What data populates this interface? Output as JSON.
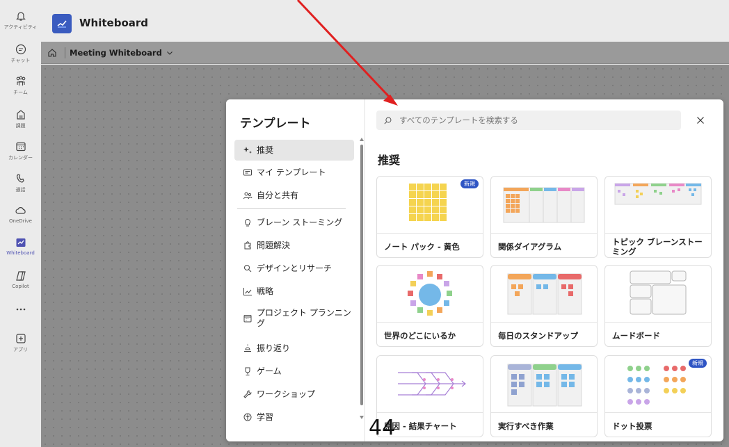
{
  "rail": {
    "items": [
      {
        "label": "アクティビティ",
        "icon": "bell-icon"
      },
      {
        "label": "チャット",
        "icon": "chat-icon"
      },
      {
        "label": "チーム",
        "icon": "teams-icon"
      },
      {
        "label": "課題",
        "icon": "assignment-icon"
      },
      {
        "label": "カレンダー",
        "icon": "calendar-icon"
      },
      {
        "label": "通話",
        "icon": "phone-icon"
      },
      {
        "label": "OneDrive",
        "icon": "cloud-icon"
      },
      {
        "label": "Whiteboard",
        "icon": "whiteboard-icon"
      },
      {
        "label": "Copilot",
        "icon": "copilot-icon"
      },
      {
        "label": "アプリ",
        "icon": "add-app-icon"
      }
    ],
    "active": "Whiteboard",
    "accent": "#4f52b2"
  },
  "header": {
    "app_title": "Whiteboard"
  },
  "breadcrumb": {
    "title": "Meeting Whiteboard"
  },
  "dialog": {
    "title": "テンプレート",
    "categories": [
      {
        "label": "推奨",
        "icon": "sparkle-icon",
        "selected": true
      },
      {
        "label": "マイ テンプレート",
        "icon": "template-icon"
      },
      {
        "label": "自分と共有",
        "icon": "people-icon"
      },
      {
        "label": "ブレーン ストーミング",
        "icon": "lightbulb-icon"
      },
      {
        "label": "問題解決",
        "icon": "puzzle-icon"
      },
      {
        "label": "デザインとリサーチ",
        "icon": "search-icon"
      },
      {
        "label": "戦略",
        "icon": "chart-icon"
      },
      {
        "label": "プロジェクト プランニング",
        "icon": "calendar-icon"
      },
      {
        "label": "振り返り",
        "icon": "retro-icon"
      },
      {
        "label": "ゲーム",
        "icon": "trophy-icon"
      },
      {
        "label": "ワークショップ",
        "icon": "wrench-icon"
      },
      {
        "label": "学習",
        "icon": "learning-icon"
      }
    ],
    "search": {
      "placeholder": "すべてのテンプレートを検索する"
    },
    "section_title": "推奨",
    "templates": [
      {
        "label": "ノート パック - 黄色",
        "badge": "新規"
      },
      {
        "label": "関係ダイアグラム"
      },
      {
        "label": "トピック ブレーンストーミング"
      },
      {
        "label": "世界のどこにいるか"
      },
      {
        "label": "毎日のスタンドアップ"
      },
      {
        "label": "ムードボード"
      },
      {
        "label": "原因 - 結果チャート"
      },
      {
        "label": "実行すべき作業"
      },
      {
        "label": "ドット投票",
        "badge": "新規"
      }
    ],
    "badge_color": "#2f55c4"
  },
  "annotation": {
    "page_number": "44",
    "arrow_color": "#e02020"
  }
}
